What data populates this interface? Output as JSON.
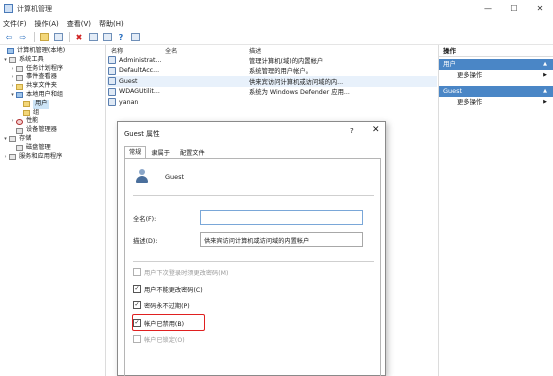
{
  "window": {
    "title": "计算机管理",
    "minimize": "—",
    "maximize": "☐",
    "close": "✕"
  },
  "menu": [
    "文件(F)",
    "操作(A)",
    "查看(V)",
    "帮助(H)"
  ],
  "toolbar": {
    "back": "⇦",
    "forward": "⇨",
    "delete": "✖",
    "help": "?"
  },
  "tree": [
    {
      "label": "计算机管理(本地)",
      "arrow": "",
      "icon": "folder"
    },
    {
      "label": "系统工具",
      "arrow": "▾",
      "icon": "folder"
    },
    {
      "label": "任务计划程序",
      "arrow": "›",
      "icon": "gray"
    },
    {
      "label": "事件查看器",
      "arrow": "›",
      "icon": "gray"
    },
    {
      "label": "共享文件夹",
      "arrow": "›",
      "icon": "folder"
    },
    {
      "label": "本地用户和组",
      "arrow": "▾",
      "icon": "blue"
    },
    {
      "label": "用户",
      "arrow": "",
      "icon": "folder",
      "selected": true
    },
    {
      "label": "组",
      "arrow": "",
      "icon": "folder"
    },
    {
      "label": "性能",
      "arrow": "›",
      "icon": "gray"
    },
    {
      "label": "设备管理器",
      "arrow": "",
      "icon": "gray"
    },
    {
      "label": "存储",
      "arrow": "▾",
      "icon": "gray"
    },
    {
      "label": "磁盘管理",
      "arrow": "",
      "icon": "gray"
    },
    {
      "label": "服务和应用程序",
      "arrow": "›",
      "icon": "gray"
    }
  ],
  "list": {
    "headers": {
      "name": "名称",
      "fullname": "全名",
      "desc": "描述"
    },
    "rows": [
      {
        "name": "Administrat...",
        "desc": "管理计算机(域)的内置帐户"
      },
      {
        "name": "DefaultAcc...",
        "desc": "系统管理的用户帐户。"
      },
      {
        "name": "Guest",
        "desc": "供来宾访问计算机或访问域的内..."
      },
      {
        "name": "WDAGUtilit...",
        "desc": "系统为 Windows Defender 应用..."
      },
      {
        "name": "yanan",
        "desc": ""
      }
    ]
  },
  "actions": {
    "title": "操作",
    "groups": [
      {
        "name": "用户",
        "link": "更多操作"
      },
      {
        "name": "Guest",
        "link": "更多操作"
      }
    ],
    "caret": "▲",
    "more": "▶"
  },
  "dialog": {
    "title": "Guest 属性",
    "help": "?",
    "close": "✕",
    "tabs": [
      "常规",
      "隶属于",
      "配置文件"
    ],
    "username": "Guest",
    "fullname_label": "全名(F):",
    "fullname_value": "",
    "desc_label": "描述(D):",
    "desc_value": "供来宾访问计算机或访问域的内置帐户",
    "checkboxes": [
      {
        "label": "用户下次登录时须更改密码(M)",
        "checked": false,
        "disabled": true,
        "mark": ""
      },
      {
        "label": "用户不能更改密码(C)",
        "checked": true,
        "disabled": false,
        "mark": "✓"
      },
      {
        "label": "密码永不过期(P)",
        "checked": true,
        "disabled": false,
        "mark": "✓"
      },
      {
        "label": "帐户已禁用(B)",
        "checked": true,
        "disabled": false,
        "mark": "✓"
      },
      {
        "label": "帐户已锁定(O)",
        "checked": false,
        "disabled": true,
        "mark": ""
      }
    ]
  },
  "colors": {
    "accent": "#4a86c6",
    "highlight": "#e02020"
  }
}
